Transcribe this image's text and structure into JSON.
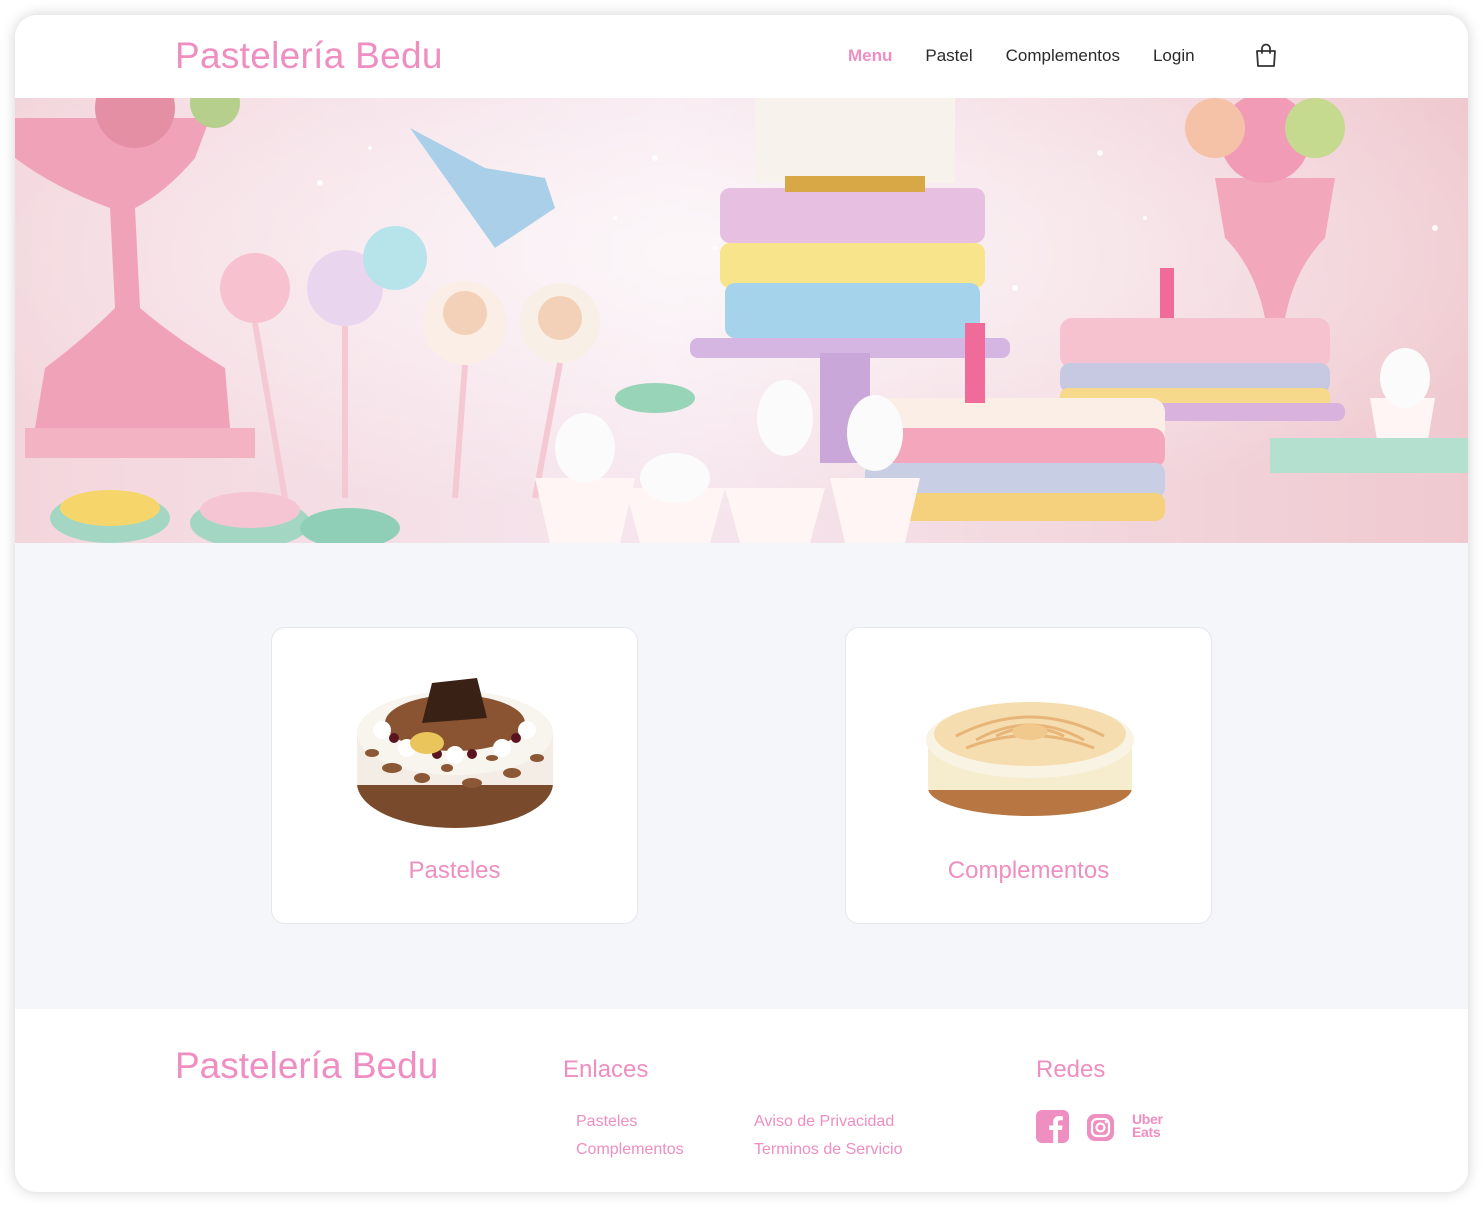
{
  "header": {
    "brand": "Pastelería Bedu",
    "nav": [
      "Menu",
      "Pastel",
      "Complementos",
      "Login"
    ],
    "active_nav": "Menu",
    "cart_icon": "shopping-bag-icon"
  },
  "hero": {
    "image": "pastel-party-table-with-unicorn-cakes"
  },
  "cards": [
    {
      "title": "Pasteles",
      "image": "chocolate-cake"
    },
    {
      "title": "Complementos",
      "image": "meringue-pie"
    }
  ],
  "footer": {
    "brand": "Pastelería Bedu",
    "enlaces_heading": "Enlaces",
    "links_col1": [
      "Pasteles",
      "Complementos"
    ],
    "links_col2": [
      "Aviso de Privacidad",
      "Terminos de Servicio"
    ],
    "redes_heading": "Redes",
    "social_icons": [
      "facebook-icon",
      "instagram-icon",
      "uber-eats-icon"
    ],
    "uber_line1": "Uber",
    "uber_line2": "Eats"
  },
  "colors": {
    "accent": "#ee8ec1",
    "content_bg": "#f5f6fa"
  }
}
